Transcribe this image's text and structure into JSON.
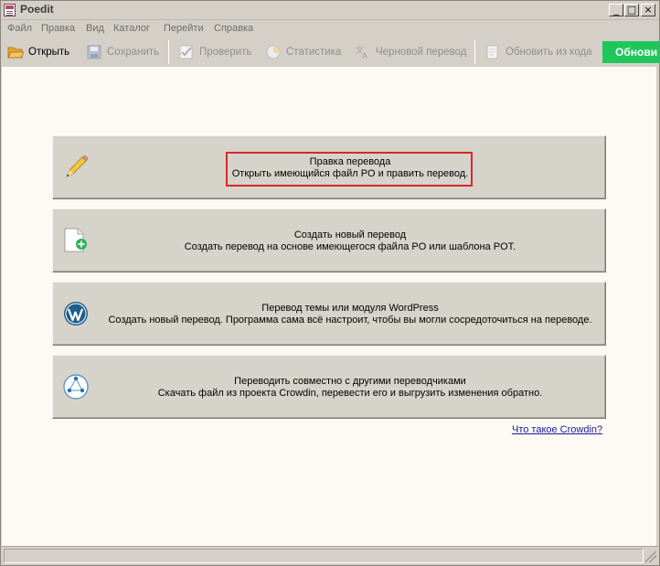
{
  "window": {
    "title": "Poedit",
    "minimize": "_",
    "maximize": "□",
    "close": "×"
  },
  "menu": [
    "Файл",
    "Правка",
    "Вид",
    "Каталог",
    "Перейти",
    "Справка"
  ],
  "toolbar": {
    "open": "Открыть",
    "save": "Сохранить",
    "validate": "Проверить",
    "statistics": "Статистика",
    "pretranslate": "Черновой перевод",
    "update_from_code": "Обновить из кода",
    "update_button": "Обнови"
  },
  "cards": [
    {
      "title": "Правка перевода",
      "subtitle": "Открыть имеющийся файл PO и править перевод.",
      "icon": "pencil-icon",
      "highlighted": true
    },
    {
      "title": "Создать новый перевод",
      "subtitle": "Создать перевод на основе имеющегося файла PO или шаблона POT.",
      "icon": "new-document-icon",
      "highlighted": false
    },
    {
      "title": "Перевод темы или модуля WordPress",
      "subtitle": "Создать новый перевод. Программа сама всё настроит, чтобы вы могли сосредоточиться на переводе.",
      "icon": "wordpress-icon",
      "highlighted": false
    },
    {
      "title": "Переводить совместно с другими переводчиками",
      "subtitle": "Скачать файл из проекта Crowdin, перевести его и выгрузить изменения обратно.",
      "icon": "crowdin-icon",
      "highlighted": false
    }
  ],
  "crowdin_link": "Что такое Crowdin?",
  "colors": {
    "highlight": "#d9282b",
    "update_button": "#1fc75a",
    "content_bg": "#fcfaf3",
    "card_bg": "#d6d3cb"
  }
}
